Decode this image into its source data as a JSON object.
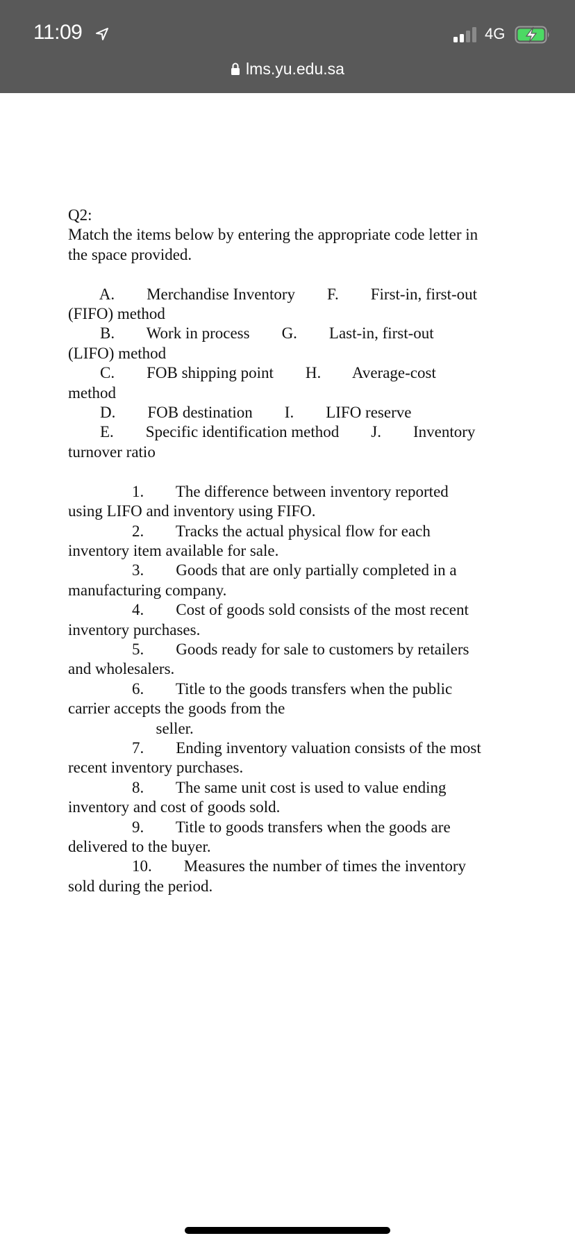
{
  "status_bar": {
    "time": "11:09",
    "location_icon": "location-arrow-icon",
    "signal_icon": "cellular-signal-icon",
    "signal_bars_filled": 2,
    "signal_bars_total": 4,
    "network": "4G",
    "battery_icon": "battery-charging-icon",
    "battery_color": "#4cd964"
  },
  "browser": {
    "lock_icon": "lock-icon",
    "url": "lms.yu.edu.sa"
  },
  "document": {
    "lines": [
      "Q2:",
      "Match the items below by entering the appropriate code letter in",
      "the space provided.",
      "",
      "        A.        Merchandise Inventory        F.        First-in, first-out",
      "(FIFO) method",
      "        B.        Work in process        G.        Last-in, first-out",
      "(LIFO) method",
      "        C.        FOB shipping point        H.        Average-cost",
      "method",
      "        D.        FOB destination        I.        LIFO reserve",
      "        E.        Specific identification method        J.        Inventory",
      "turnover ratio",
      "",
      "                1.        The difference between inventory reported",
      "using LIFO and inventory using FIFO.",
      "                2.        Tracks the actual physical flow for each",
      "inventory item available for sale.",
      "                3.        Goods that are only partially completed in a",
      "manufacturing company.",
      "                4.        Cost of goods sold consists of the most recent",
      "inventory purchases.",
      "                5.        Goods ready for sale to customers by retailers",
      "and wholesalers.",
      "                6.        Title to the goods transfers when the public",
      "carrier accepts the goods from the",
      "                      seller.",
      "                7.        Ending inventory valuation consists of the most",
      "recent inventory purchases.",
      "                8.        The same unit cost is used to value ending",
      "inventory and cost of goods sold.",
      "                9.        Title to goods transfers when the goods are",
      "delivered to the buyer.",
      "                10.        Measures the number of times the inventory",
      "sold during the period."
    ]
  }
}
